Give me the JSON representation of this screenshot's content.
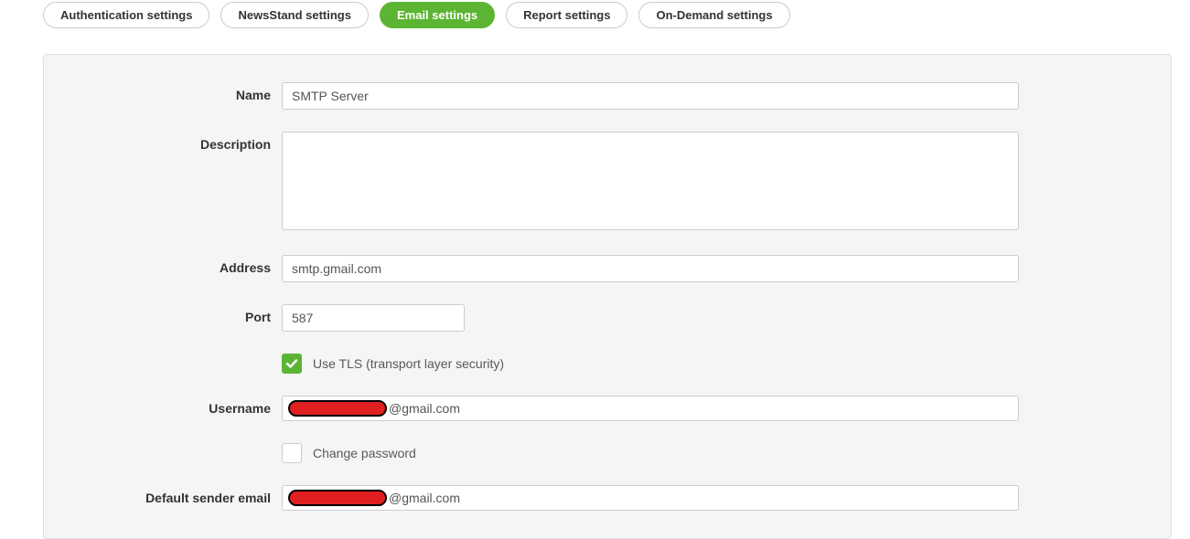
{
  "tabs": {
    "auth": "Authentication settings",
    "newsstand": "NewsStand settings",
    "email": "Email settings",
    "report": "Report settings",
    "ondemand": "On-Demand settings"
  },
  "form": {
    "name_label": "Name",
    "name_value": "SMTP Server",
    "description_label": "Description",
    "description_value": "",
    "address_label": "Address",
    "address_value": "smtp.gmail.com",
    "port_label": "Port",
    "port_value": "587",
    "tls_label": "Use TLS (transport layer security)",
    "username_label": "Username",
    "username_suffix": "@gmail.com",
    "change_password_label": "Change password",
    "default_sender_label": "Default sender email",
    "default_sender_suffix": "@gmail.com"
  }
}
